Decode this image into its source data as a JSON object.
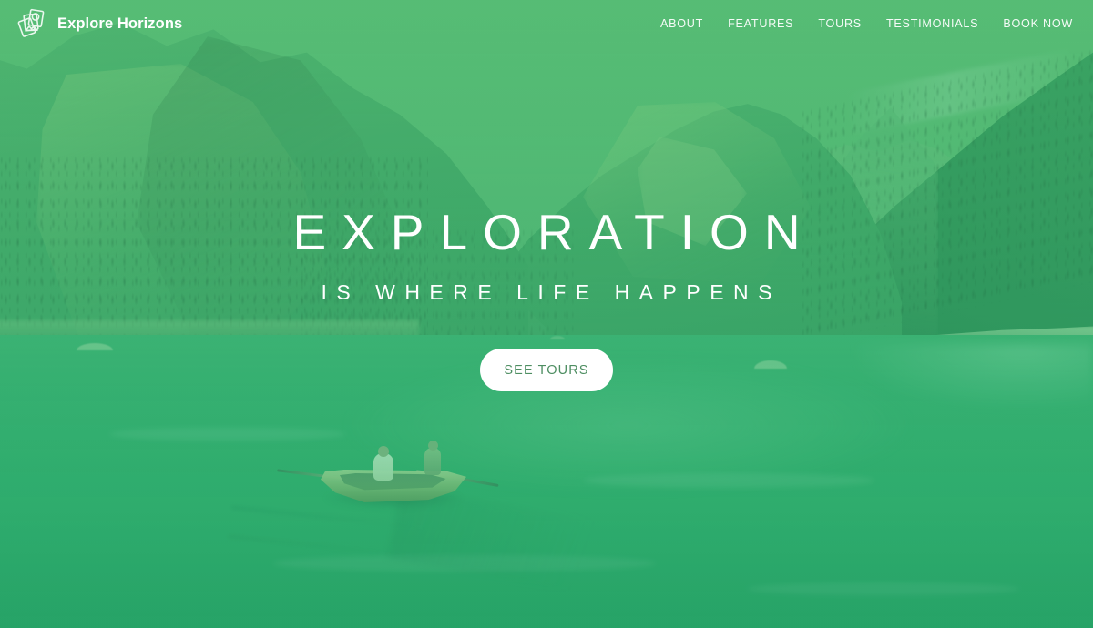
{
  "brand": {
    "name": "Explore Horizons",
    "logo_icon": "stacked-photo-cards-icon"
  },
  "nav": {
    "items": [
      {
        "label": "ABOUT"
      },
      {
        "label": "FEATURES"
      },
      {
        "label": "TOURS"
      },
      {
        "label": "TESTIMONIALS"
      },
      {
        "label": "BOOK NOW"
      }
    ]
  },
  "hero": {
    "title": "EXPLORATION",
    "subtitle": "IS WHERE LIFE HAPPENS",
    "cta_label": "SEE TOURS",
    "background_scene": "alpine lake with rowboat, forested mountains"
  },
  "colors": {
    "overlay_green": "#58C882",
    "sky": "#6FC98C",
    "water": "#3BB87A",
    "cta_background": "#FFFFFF",
    "cta_text": "#4E8E62",
    "nav_text": "#FFFFFF"
  }
}
